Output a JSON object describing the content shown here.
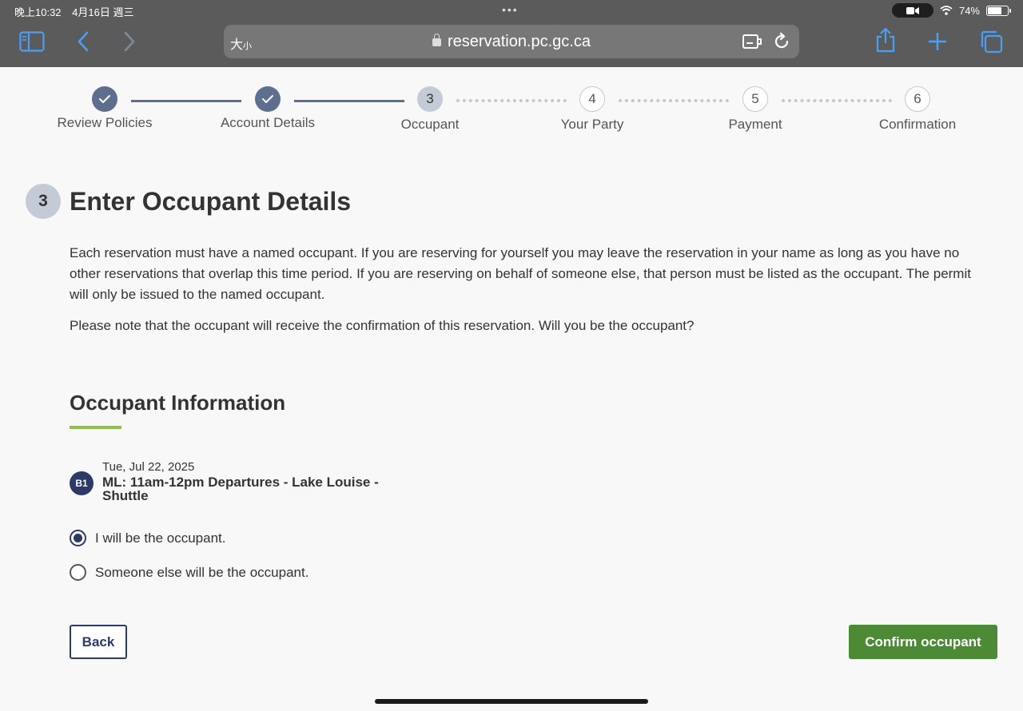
{
  "status_bar": {
    "time": "晚上10:32",
    "date": "4月16日 週三",
    "battery": "74%",
    "battery_level": 0.74
  },
  "browser": {
    "text_size_label": "大",
    "text_size_small": "小",
    "url": "reservation.pc.gc.ca",
    "icons": [
      "sidebar-icon",
      "back-arrow-icon",
      "forward-arrow-icon",
      "lock-icon",
      "extension-icon",
      "reload-icon",
      "share-icon",
      "new-tab-icon",
      "tabs-icon"
    ]
  },
  "stepper": {
    "steps": [
      {
        "number": "1",
        "label": "Review Policies",
        "state": "done"
      },
      {
        "number": "2",
        "label": "Account Details",
        "state": "done"
      },
      {
        "number": "3",
        "label": "Occupant",
        "state": "current"
      },
      {
        "number": "4",
        "label": "Your Party",
        "state": "todo"
      },
      {
        "number": "5",
        "label": "Payment",
        "state": "todo"
      },
      {
        "number": "6",
        "label": "Confirmation",
        "state": "todo"
      }
    ]
  },
  "main": {
    "step_number": "3",
    "title": "Enter Occupant Details",
    "paragraph_1": "Each reservation must have a named occupant. If you are reserving for yourself you may leave the reservation in your name as long as you have no other reservations that overlap this time period. If you are reserving on behalf of someone else, that person must be listed as the occupant. The permit will only be issued to the named occupant.",
    "paragraph_2": "Please note that the occupant will receive the confirmation of this reservation. Will you be the occupant?",
    "section_title": "Occupant Information",
    "reservation": {
      "badge": "B1",
      "date": "Tue, Jul 22, 2025",
      "name": "ML: 11am-12pm Departures - Lake Louise - Shuttle"
    },
    "options": [
      {
        "label": "I will be the occupant.",
        "checked": true
      },
      {
        "label": "Someone else will be the occupant.",
        "checked": false
      }
    ],
    "back_label": "Back",
    "confirm_label": "Confirm occupant"
  },
  "colors": {
    "chrome": "#5b5b5b",
    "step_done": "#5e6f8e",
    "step_current": "#c5cad7",
    "navy": "#2b3a67",
    "accent_green": "#8bc34a",
    "confirm_green": "#4c8a35"
  }
}
